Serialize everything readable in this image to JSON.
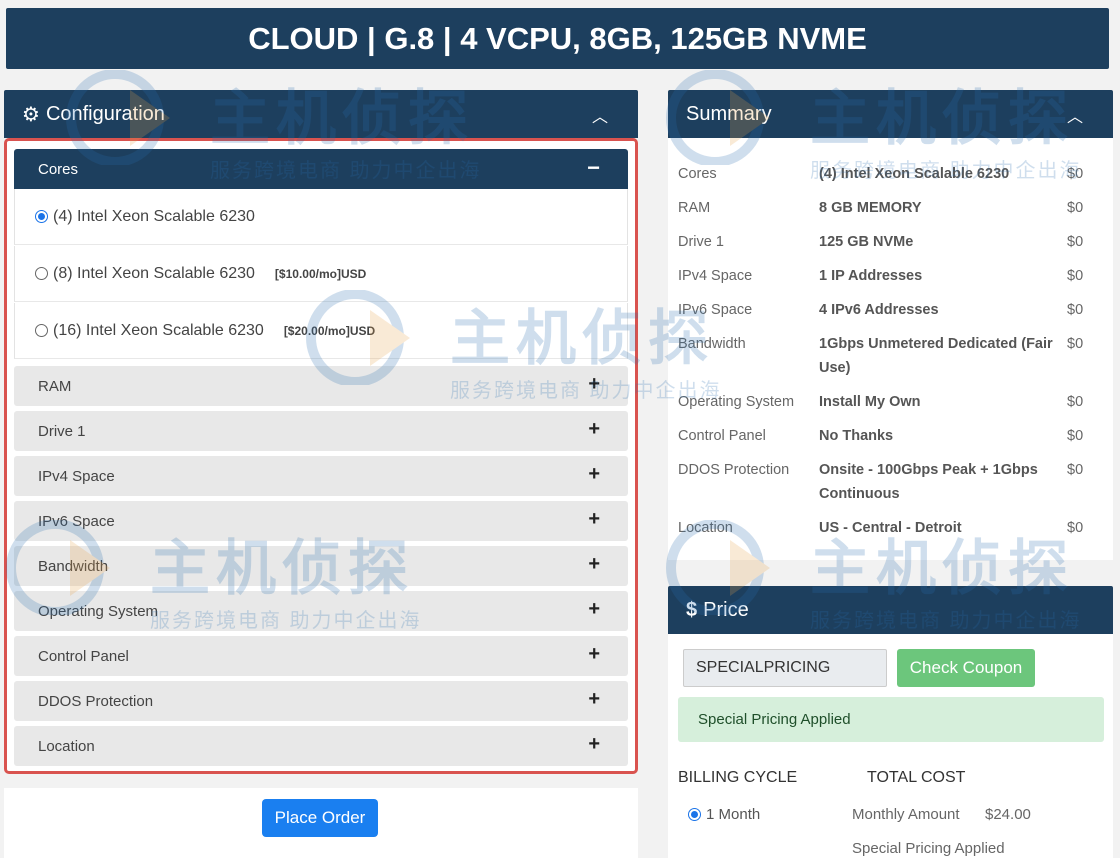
{
  "title": "CLOUD | G.8 | 4 VCPU, 8GB, 125GB NVME",
  "configuration": {
    "heading": "Configuration",
    "cores": {
      "label": "Cores",
      "options": [
        {
          "label": "(4) Intel Xeon Scalable 6230",
          "price": "",
          "selected": true
        },
        {
          "label": "(8) Intel Xeon Scalable 6230",
          "price": "[$10.00/mo]USD",
          "selected": false
        },
        {
          "label": "(16) Intel Xeon Scalable 6230",
          "price": "[$20.00/mo]USD",
          "selected": false
        }
      ]
    },
    "sections": [
      "RAM",
      "Drive 1",
      "IPv4 Space",
      "IPv6 Space",
      "Bandwidth",
      "Operating System",
      "Control Panel",
      "DDOS Protection",
      "Location"
    ]
  },
  "place_order_label": "Place Order",
  "summary": {
    "heading": "Summary",
    "rows": [
      {
        "key": "Cores",
        "value": "(4) Intel Xeon Scalable 6230",
        "price": "$0"
      },
      {
        "key": "RAM",
        "value": "8 GB MEMORY",
        "price": "$0"
      },
      {
        "key": "Drive 1",
        "value": "125 GB NVMe",
        "price": "$0"
      },
      {
        "key": "IPv4 Space",
        "value": "1 IP Addresses",
        "price": "$0"
      },
      {
        "key": "IPv6 Space",
        "value": "4 IPv6 Addresses",
        "price": "$0"
      },
      {
        "key": "Bandwidth",
        "value": "1Gbps Unmetered Dedicated (Fair Use)",
        "price": "$0"
      },
      {
        "key": "Operating System",
        "value": "Install My Own",
        "price": "$0"
      },
      {
        "key": "Control Panel",
        "value": "No Thanks",
        "price": "$0"
      },
      {
        "key": "DDOS Protection",
        "value": "Onsite - 100Gbps Peak + 1Gbps Continuous",
        "price": "$0"
      },
      {
        "key": "Location",
        "value": "US - Central - Detroit",
        "price": "$0"
      }
    ]
  },
  "price": {
    "heading": "Price",
    "coupon_value": "SPECIALPRICING",
    "check_coupon_label": "Check Coupon",
    "alert": "Special Pricing Applied",
    "billing_cycle_label": "BILLING CYCLE",
    "total_cost_label": "TOTAL COST",
    "cycle_option": "1 Month",
    "monthly_amount_label": "Monthly Amount",
    "monthly_amount_value": "$24.00",
    "special_note": "Special Pricing Applied"
  },
  "watermark": {
    "main": "主机侦探",
    "sub": "服务跨境电商 助力中企出海"
  },
  "colors": {
    "navy": "#1d3f5e",
    "accent_blue": "#1a7ff0",
    "green": "#6cc67c",
    "alert_bg": "#d6efdb",
    "highlight_border": "#d9534f"
  }
}
